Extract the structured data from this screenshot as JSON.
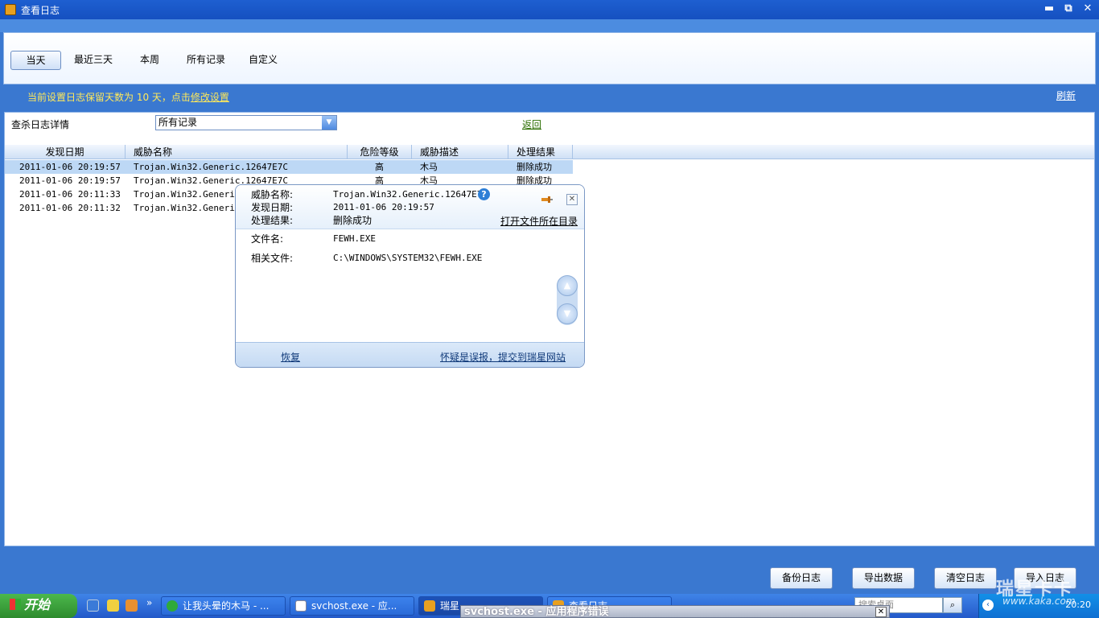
{
  "window": {
    "title": "查看日志",
    "minimize": "▬",
    "restore": "⧉",
    "close": "✕"
  },
  "filters": {
    "items": [
      "当天",
      "最近三天",
      "本周",
      "所有记录",
      "自定义"
    ],
    "active_index": 0
  },
  "notice": {
    "text": "当前设置日志保留天数为 10 天，点击",
    "link": "修改设置"
  },
  "refresh": "刷新",
  "detail": {
    "label": "查杀日志详情",
    "select_value": "所有记录",
    "back": "返回"
  },
  "table": {
    "headers": [
      "发现日期",
      "威胁名称",
      "危险等级",
      "威胁描述",
      "处理结果"
    ],
    "rows": [
      {
        "date": "2011-01-06 20:19:57",
        "name": "Trojan.Win32.Generic.12647E7C",
        "level": "高",
        "desc": "木马",
        "result": "删除成功"
      },
      {
        "date": "2011-01-06 20:19:57",
        "name": "Trojan.Win32.Generic.12647E7C",
        "level": "高",
        "desc": "木马",
        "result": "删除成功"
      },
      {
        "date": "2011-01-06 20:11:33",
        "name": "Trojan.Win32.Generic.",
        "level": "",
        "desc": "",
        "result": ""
      },
      {
        "date": "2011-01-06 20:11:32",
        "name": "Trojan.Win32.Generic.",
        "level": "",
        "desc": "",
        "result": ""
      }
    ]
  },
  "popup": {
    "threat_label": "威胁名称:",
    "threat_value": "Trojan.Win32.Generic.12647E7C",
    "date_label": "发现日期:",
    "date_value": "2011-01-06 20:19:57",
    "result_label": "处理结果:",
    "result_value": "删除成功",
    "open_dir": "打开文件所在目录",
    "file_label": "文件名:",
    "file_value": "FEWH.EXE",
    "related_label": "相关文件:",
    "related_value": "C:\\WINDOWS\\SYSTEM32\\FEWH.EXE",
    "restore": "恢复",
    "report": "怀疑是误报，提交到瑞星网站",
    "help": "?"
  },
  "buttons": {
    "backup": "备份日志",
    "export": "导出数据",
    "clear": "清空日志",
    "import": "导入日志"
  },
  "taskbar": {
    "start": "开始",
    "tasks": [
      "让我头晕的木马 - ...",
      "svchost.exe - 应...",
      "瑞星...",
      "查看日志"
    ],
    "search_placeholder": "搜索桌面",
    "clock": "20:20",
    "more": "»"
  },
  "error_dialog": {
    "title": "svchost.exe - 应用程序错误",
    "close": "✕"
  },
  "watermark": {
    "brand": "瑞星卡卡",
    "url": "www.kaka.com"
  }
}
